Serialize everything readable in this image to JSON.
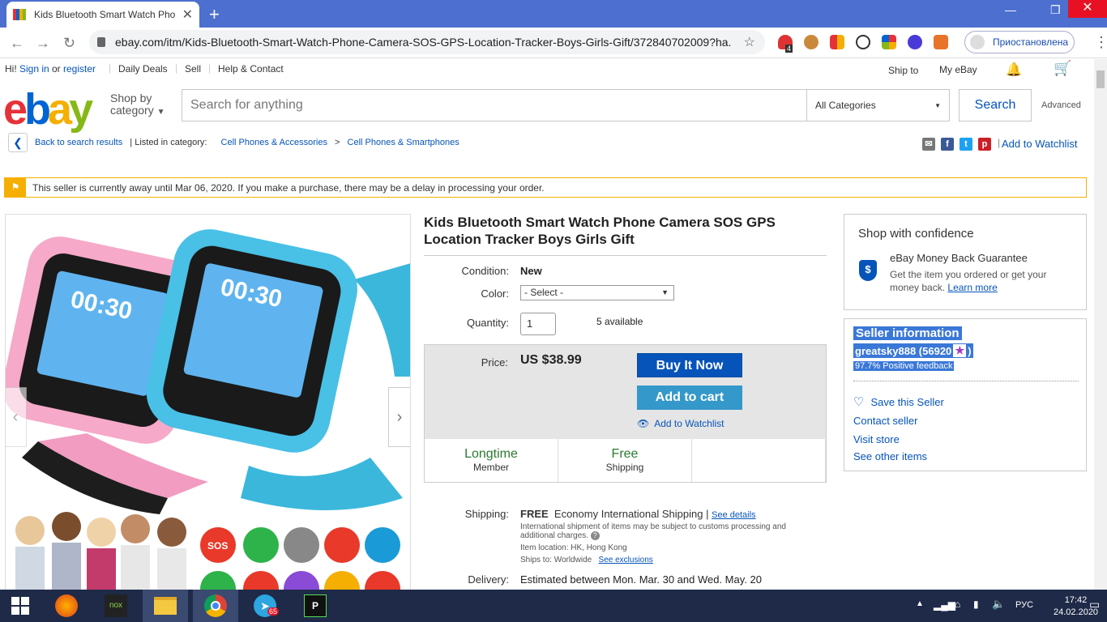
{
  "browser": {
    "tab_title": "Kids Bluetooth Smart Watch Pho",
    "url": "ebay.com/itm/Kids-Bluetooth-Smart-Watch-Phone-Camera-SOS-GPS-Location-Tracker-Boys-Girls-Gift/372840702009?ha...",
    "profile_label": "Приостановлена",
    "extension_badge": "4"
  },
  "topnav": {
    "hi": "Hi!",
    "sign_in": "Sign in",
    "or": "or",
    "register": "register",
    "daily_deals": "Daily Deals",
    "sell": "Sell",
    "help_contact": "Help & Contact",
    "ship_to": "Ship to",
    "my_ebay": "My eBay"
  },
  "header": {
    "logo": [
      "e",
      "b",
      "a",
      "y"
    ],
    "shop_by": "Shop by",
    "category": "category",
    "search_placeholder": "Search for anything",
    "all_categories": "All Categories",
    "search_button": "Search",
    "advanced": "Advanced"
  },
  "breadcrumb": {
    "back": "Back to search results",
    "listed_in": "| Listed in category:",
    "cat1": "Cell Phones & Accessories",
    "sep": ">",
    "cat2": "Cell Phones & Smartphones",
    "add_to_watchlist": "Add to Watchlist"
  },
  "alert": {
    "text": "This seller is currently away until Mar 06, 2020. If you make a purchase, there may be a delay in processing your order."
  },
  "product": {
    "title": "Kids Bluetooth Smart Watch Phone Camera SOS GPS Location Tracker Boys Girls Gift",
    "condition_label": "Condition:",
    "condition": "New",
    "color_label": "Color:",
    "color_value": "- Select -",
    "quantity_label": "Quantity:",
    "quantity": "1",
    "available": "5 available",
    "price_label": "Price:",
    "price": "US $38.99",
    "buy_now": "Buy It Now",
    "add_to_cart": "Add to cart",
    "add_to_watchlist": "Add to Watchlist",
    "badges": [
      {
        "big": "Longtime",
        "small": "Member"
      },
      {
        "big": "Free",
        "small": "Shipping"
      }
    ],
    "watch_time": "00:30",
    "sos": "SOS",
    "shipping_label": "Shipping:",
    "shipping_free": "FREE",
    "shipping_method": "Economy International Shipping",
    "shipping_sep": "|",
    "see_details": "See details",
    "intl_note": "International shipment of items may be subject to customs processing and additional charges.",
    "item_location": "Item location:  HK, Hong Kong",
    "ships_to": "Ships to:  Worldwide",
    "see_exclusions": "See exclusions",
    "delivery_label": "Delivery:",
    "delivery": "Estimated between Mon. Mar. 30 and Wed. May. 20"
  },
  "confidence": {
    "title": "Shop with confidence",
    "guarantee": "eBay Money Back Guarantee",
    "desc": "Get the item you ordered or get your money back.",
    "learn_more": "Learn more"
  },
  "seller": {
    "title": "Seller information",
    "name": "greatsky888",
    "score": "(56920",
    "score_close": ")",
    "feedback": "97.7% Positive feedback",
    "save": "Save this Seller",
    "contact": "Contact seller",
    "visit": "Visit store",
    "other": "See other items"
  },
  "taskbar": {
    "lang": "РУС",
    "time": "17:42",
    "date": "24.02.2020",
    "telegram_badge": "65",
    "nox": "nox"
  }
}
